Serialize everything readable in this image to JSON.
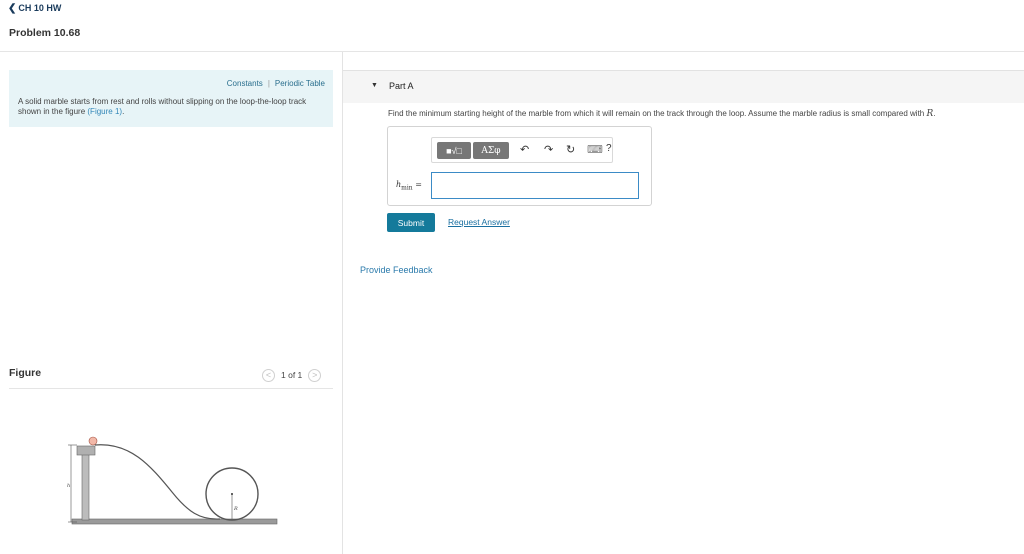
{
  "nav": {
    "back_label": "CH 10 HW"
  },
  "problem": {
    "title": "Problem 10.68"
  },
  "info_box": {
    "constants_link": "Constants",
    "separator": "|",
    "periodic_table_link": "Periodic Table",
    "text": "A solid marble starts from rest and rolls without slipping on the loop-the-loop track shown in the figure",
    "figure_link": "(Figure 1)",
    "text_end": "."
  },
  "figure_panel": {
    "label": "Figure",
    "pager_text": "1 of 1",
    "prev_glyph": "<",
    "next_glyph": ">",
    "diagram_labels": {
      "height": "h",
      "radius": "R"
    }
  },
  "part": {
    "title": "Part A",
    "question_text": "Find the minimum starting height of the marble from which it will remain on the track through the loop. Assume the marble radius is small compared with",
    "question_var": "R",
    "question_end": ".",
    "answer": {
      "variable": "h",
      "variable_sub": "min",
      "equals": "=",
      "value": ""
    }
  },
  "toolbar": {
    "templates_glyph": "■√□",
    "symbols_label": "ΑΣφ",
    "undo_glyph": "↶",
    "redo_glyph": "↷",
    "reset_glyph": "↻",
    "keyboard_glyph": "⌨",
    "help_glyph": "?"
  },
  "actions": {
    "submit_label": "Submit",
    "request_answer_label": "Request Answer",
    "feedback_label": "Provide Feedback"
  }
}
